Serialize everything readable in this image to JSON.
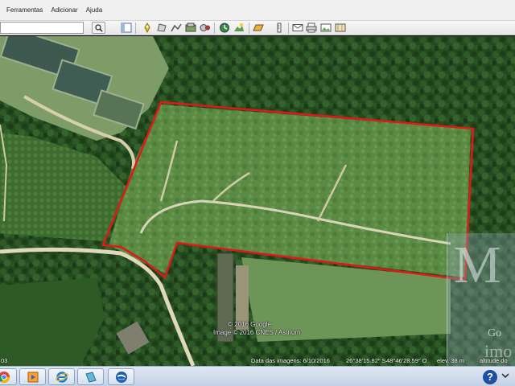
{
  "menu": {
    "items": [
      "Ferramentas",
      "Adicionar",
      "Ajuda"
    ]
  },
  "toolbar": {
    "search_value": "",
    "icons": [
      "search-icon",
      "sidebar-icon",
      "add-placemark-icon",
      "add-polygon-icon",
      "add-path-icon",
      "add-overlay-icon",
      "record-tour-icon",
      "historical-imagery-icon",
      "sunlight-icon",
      "planets-icon",
      "ruler-icon",
      "email-icon",
      "print-icon",
      "save-image-icon"
    ]
  },
  "map": {
    "attribution_line1": "© 2016 Google",
    "attribution_line2": "Image © 2016 CNES / Astrium",
    "imagery_date": "Data das imagens: 6/10/2016",
    "latitude": "26°38'15.82\" S",
    "longitude": "48°46'28.59\" O",
    "elevation": "elev.  38 m",
    "eye_altitude": "altitude do",
    "left_edge": "03",
    "boundary_color": "#e01818"
  },
  "watermark": {
    "letter": "M",
    "go": "Go",
    "imo": "imo"
  },
  "taskbar": {
    "apps": [
      "chrome-icon",
      "media-player-icon",
      "internet-explorer-icon",
      "documents-icon",
      "google-earth-icon"
    ],
    "help_label": "?"
  }
}
